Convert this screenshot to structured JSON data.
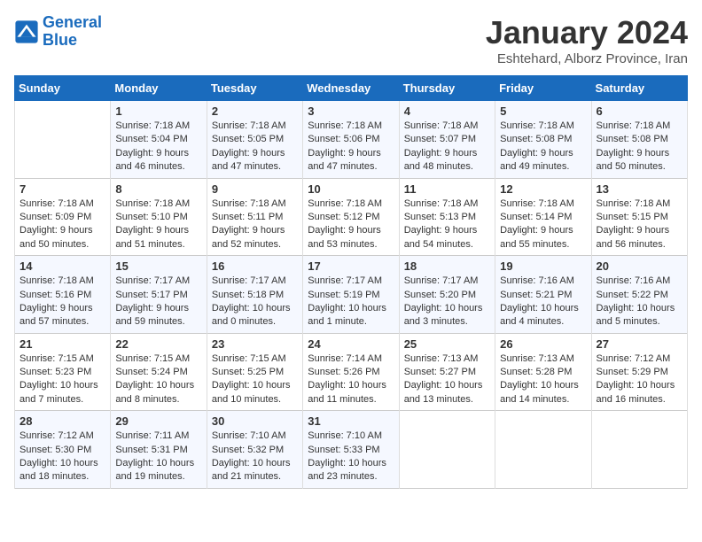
{
  "logo": {
    "line1": "General",
    "line2": "Blue"
  },
  "title": "January 2024",
  "location": "Eshtehard, Alborz Province, Iran",
  "days_of_week": [
    "Sunday",
    "Monday",
    "Tuesday",
    "Wednesday",
    "Thursday",
    "Friday",
    "Saturday"
  ],
  "weeks": [
    [
      {
        "day": "",
        "sunrise": "",
        "sunset": "",
        "daylight": ""
      },
      {
        "day": "1",
        "sunrise": "Sunrise: 7:18 AM",
        "sunset": "Sunset: 5:04 PM",
        "daylight": "Daylight: 9 hours and 46 minutes."
      },
      {
        "day": "2",
        "sunrise": "Sunrise: 7:18 AM",
        "sunset": "Sunset: 5:05 PM",
        "daylight": "Daylight: 9 hours and 47 minutes."
      },
      {
        "day": "3",
        "sunrise": "Sunrise: 7:18 AM",
        "sunset": "Sunset: 5:06 PM",
        "daylight": "Daylight: 9 hours and 47 minutes."
      },
      {
        "day": "4",
        "sunrise": "Sunrise: 7:18 AM",
        "sunset": "Sunset: 5:07 PM",
        "daylight": "Daylight: 9 hours and 48 minutes."
      },
      {
        "day": "5",
        "sunrise": "Sunrise: 7:18 AM",
        "sunset": "Sunset: 5:08 PM",
        "daylight": "Daylight: 9 hours and 49 minutes."
      },
      {
        "day": "6",
        "sunrise": "Sunrise: 7:18 AM",
        "sunset": "Sunset: 5:08 PM",
        "daylight": "Daylight: 9 hours and 50 minutes."
      }
    ],
    [
      {
        "day": "7",
        "sunrise": "Sunrise: 7:18 AM",
        "sunset": "Sunset: 5:09 PM",
        "daylight": "Daylight: 9 hours and 50 minutes."
      },
      {
        "day": "8",
        "sunrise": "Sunrise: 7:18 AM",
        "sunset": "Sunset: 5:10 PM",
        "daylight": "Daylight: 9 hours and 51 minutes."
      },
      {
        "day": "9",
        "sunrise": "Sunrise: 7:18 AM",
        "sunset": "Sunset: 5:11 PM",
        "daylight": "Daylight: 9 hours and 52 minutes."
      },
      {
        "day": "10",
        "sunrise": "Sunrise: 7:18 AM",
        "sunset": "Sunset: 5:12 PM",
        "daylight": "Daylight: 9 hours and 53 minutes."
      },
      {
        "day": "11",
        "sunrise": "Sunrise: 7:18 AM",
        "sunset": "Sunset: 5:13 PM",
        "daylight": "Daylight: 9 hours and 54 minutes."
      },
      {
        "day": "12",
        "sunrise": "Sunrise: 7:18 AM",
        "sunset": "Sunset: 5:14 PM",
        "daylight": "Daylight: 9 hours and 55 minutes."
      },
      {
        "day": "13",
        "sunrise": "Sunrise: 7:18 AM",
        "sunset": "Sunset: 5:15 PM",
        "daylight": "Daylight: 9 hours and 56 minutes."
      }
    ],
    [
      {
        "day": "14",
        "sunrise": "Sunrise: 7:18 AM",
        "sunset": "Sunset: 5:16 PM",
        "daylight": "Daylight: 9 hours and 57 minutes."
      },
      {
        "day": "15",
        "sunrise": "Sunrise: 7:17 AM",
        "sunset": "Sunset: 5:17 PM",
        "daylight": "Daylight: 9 hours and 59 minutes."
      },
      {
        "day": "16",
        "sunrise": "Sunrise: 7:17 AM",
        "sunset": "Sunset: 5:18 PM",
        "daylight": "Daylight: 10 hours and 0 minutes."
      },
      {
        "day": "17",
        "sunrise": "Sunrise: 7:17 AM",
        "sunset": "Sunset: 5:19 PM",
        "daylight": "Daylight: 10 hours and 1 minute."
      },
      {
        "day": "18",
        "sunrise": "Sunrise: 7:17 AM",
        "sunset": "Sunset: 5:20 PM",
        "daylight": "Daylight: 10 hours and 3 minutes."
      },
      {
        "day": "19",
        "sunrise": "Sunrise: 7:16 AM",
        "sunset": "Sunset: 5:21 PM",
        "daylight": "Daylight: 10 hours and 4 minutes."
      },
      {
        "day": "20",
        "sunrise": "Sunrise: 7:16 AM",
        "sunset": "Sunset: 5:22 PM",
        "daylight": "Daylight: 10 hours and 5 minutes."
      }
    ],
    [
      {
        "day": "21",
        "sunrise": "Sunrise: 7:15 AM",
        "sunset": "Sunset: 5:23 PM",
        "daylight": "Daylight: 10 hours and 7 minutes."
      },
      {
        "day": "22",
        "sunrise": "Sunrise: 7:15 AM",
        "sunset": "Sunset: 5:24 PM",
        "daylight": "Daylight: 10 hours and 8 minutes."
      },
      {
        "day": "23",
        "sunrise": "Sunrise: 7:15 AM",
        "sunset": "Sunset: 5:25 PM",
        "daylight": "Daylight: 10 hours and 10 minutes."
      },
      {
        "day": "24",
        "sunrise": "Sunrise: 7:14 AM",
        "sunset": "Sunset: 5:26 PM",
        "daylight": "Daylight: 10 hours and 11 minutes."
      },
      {
        "day": "25",
        "sunrise": "Sunrise: 7:13 AM",
        "sunset": "Sunset: 5:27 PM",
        "daylight": "Daylight: 10 hours and 13 minutes."
      },
      {
        "day": "26",
        "sunrise": "Sunrise: 7:13 AM",
        "sunset": "Sunset: 5:28 PM",
        "daylight": "Daylight: 10 hours and 14 minutes."
      },
      {
        "day": "27",
        "sunrise": "Sunrise: 7:12 AM",
        "sunset": "Sunset: 5:29 PM",
        "daylight": "Daylight: 10 hours and 16 minutes."
      }
    ],
    [
      {
        "day": "28",
        "sunrise": "Sunrise: 7:12 AM",
        "sunset": "Sunset: 5:30 PM",
        "daylight": "Daylight: 10 hours and 18 minutes."
      },
      {
        "day": "29",
        "sunrise": "Sunrise: 7:11 AM",
        "sunset": "Sunset: 5:31 PM",
        "daylight": "Daylight: 10 hours and 19 minutes."
      },
      {
        "day": "30",
        "sunrise": "Sunrise: 7:10 AM",
        "sunset": "Sunset: 5:32 PM",
        "daylight": "Daylight: 10 hours and 21 minutes."
      },
      {
        "day": "31",
        "sunrise": "Sunrise: 7:10 AM",
        "sunset": "Sunset: 5:33 PM",
        "daylight": "Daylight: 10 hours and 23 minutes."
      },
      {
        "day": "",
        "sunrise": "",
        "sunset": "",
        "daylight": ""
      },
      {
        "day": "",
        "sunrise": "",
        "sunset": "",
        "daylight": ""
      },
      {
        "day": "",
        "sunrise": "",
        "sunset": "",
        "daylight": ""
      }
    ]
  ]
}
